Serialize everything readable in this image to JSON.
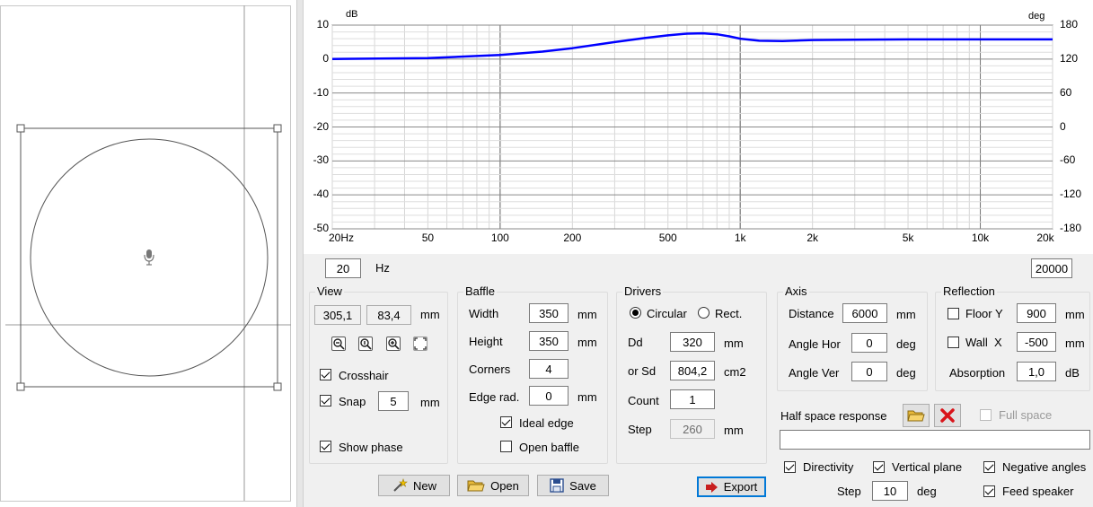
{
  "left_view": {
    "microphone_icon": "microphone-icon"
  },
  "chart_data": {
    "type": "line",
    "x_scale": "log",
    "xlim": [
      20,
      20000
    ],
    "ylim": [
      -50,
      10
    ],
    "ylim_right": [
      -180,
      180
    ],
    "left_unit": "dB",
    "right_unit": "deg",
    "y_ticks_left": [
      "10",
      "0",
      "-10",
      "-20",
      "-30",
      "-40",
      "-50"
    ],
    "y_ticks_right": [
      "180",
      "120",
      "60",
      "0",
      "-60",
      "-120",
      "-180"
    ],
    "x_ticks": [
      "20Hz",
      "50",
      "100",
      "200",
      "500",
      "1k",
      "2k",
      "5k",
      "10k",
      "20k"
    ],
    "grid": true,
    "series": [
      {
        "color": "#0000ff",
        "x": [
          20,
          50,
          100,
          150,
          200,
          300,
          400,
          500,
          600,
          700,
          800,
          900,
          1000,
          1200,
          1500,
          2000,
          3000,
          5000,
          10000,
          20000
        ],
        "y": [
          0,
          0.3,
          1.2,
          2.2,
          3.2,
          5.0,
          6.2,
          7.0,
          7.5,
          7.6,
          7.3,
          6.7,
          6.0,
          5.4,
          5.3,
          5.6,
          5.7,
          5.8,
          5.8,
          5.8
        ]
      }
    ]
  },
  "freq": {
    "min": "20",
    "unit": "Hz",
    "max": "20000"
  },
  "view": {
    "title": "View",
    "x": "305,1",
    "y": "83,4",
    "unit": "mm",
    "crosshair_label": "Crosshair",
    "crosshair_checked": true,
    "snap_label": "Snap",
    "snap_checked": true,
    "snap_value": "5",
    "snap_unit": "mm",
    "show_phase_label": "Show phase",
    "show_phase_checked": true
  },
  "baffle": {
    "title": "Baffle",
    "width_label": "Width",
    "width": "350",
    "width_unit": "mm",
    "height_label": "Height",
    "height": "350",
    "height_unit": "mm",
    "corners_label": "Corners",
    "corners": "4",
    "edge_label": "Edge rad.",
    "edge": "0",
    "edge_unit": "mm",
    "ideal_edge_label": "Ideal edge",
    "ideal_edge_checked": true,
    "open_baffle_label": "Open baffle",
    "open_baffle_checked": false
  },
  "drivers": {
    "title": "Drivers",
    "circular_label": "Circular",
    "rect_label": "Rect.",
    "circular_selected": true,
    "dd_label": "Dd",
    "dd": "320",
    "dd_unit": "mm",
    "sd_label": "or Sd",
    "sd": "804,2",
    "sd_unit": "cm2",
    "count_label": "Count",
    "count": "1",
    "step_label": "Step",
    "step": "260",
    "step_unit": "mm"
  },
  "axis": {
    "title": "Axis",
    "distance_label": "Distance",
    "distance": "6000",
    "distance_unit": "mm",
    "hor_label": "Angle Hor",
    "hor": "0",
    "hor_unit": "deg",
    "ver_label": "Angle Ver",
    "ver": "0",
    "ver_unit": "deg"
  },
  "reflection": {
    "title": "Reflection",
    "floor_label": "Floor Y",
    "floor_checked": false,
    "floor": "900",
    "floor_unit": "mm",
    "wall_label": "Wall  X",
    "wall_checked": false,
    "wall": "-500",
    "wall_unit": "mm",
    "absorption_label": "Absorption",
    "absorption": "1,0",
    "absorption_unit": "dB"
  },
  "half_space": {
    "label": "Half space response",
    "path": "",
    "full_space_label": "Full space",
    "full_space_checked": false
  },
  "options": {
    "directivity_label": "Directivity",
    "directivity_checked": true,
    "vertical_label": "Vertical plane",
    "vertical_checked": true,
    "negative_label": "Negative angles",
    "negative_checked": true,
    "step_label": "Step",
    "step": "10",
    "step_unit": "deg",
    "feed_label": "Feed speaker",
    "feed_checked": true
  },
  "buttons": {
    "new": "New",
    "open": "Open",
    "save": "Save",
    "export": "Export"
  },
  "colors": {
    "curve": "#0000ff",
    "focus": "#0078d7",
    "delete": "#d9141a",
    "folder": "#e8b93a"
  }
}
